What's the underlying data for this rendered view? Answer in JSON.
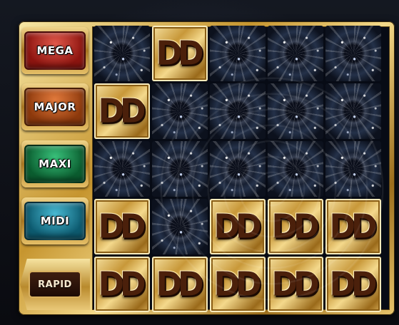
{
  "levels": [
    {
      "name": "MEGA",
      "color": "#b8231c"
    },
    {
      "name": "MAJOR",
      "color": "#b8561a"
    },
    {
      "name": "MAXI",
      "color": "#168a4a"
    },
    {
      "name": "MIDI",
      "color": "#1d8aa5"
    },
    {
      "name": "RAPID",
      "color": "#3e1e10"
    }
  ],
  "coin_symbol": {
    "text": "DD",
    "icon": "dd-coin-icon"
  },
  "grid": {
    "rows": 5,
    "columns": 5,
    "cells": [
      [
        "empty",
        "coin",
        "empty",
        "empty",
        "empty"
      ],
      [
        "coin",
        "empty",
        "empty",
        "empty",
        "empty"
      ],
      [
        "empty",
        "empty",
        "empty",
        "empty",
        "empty"
      ],
      [
        "coin",
        "empty",
        "coin",
        "coin",
        "coin"
      ],
      [
        "coin",
        "coin",
        "coin",
        "coin",
        "coin"
      ]
    ]
  }
}
